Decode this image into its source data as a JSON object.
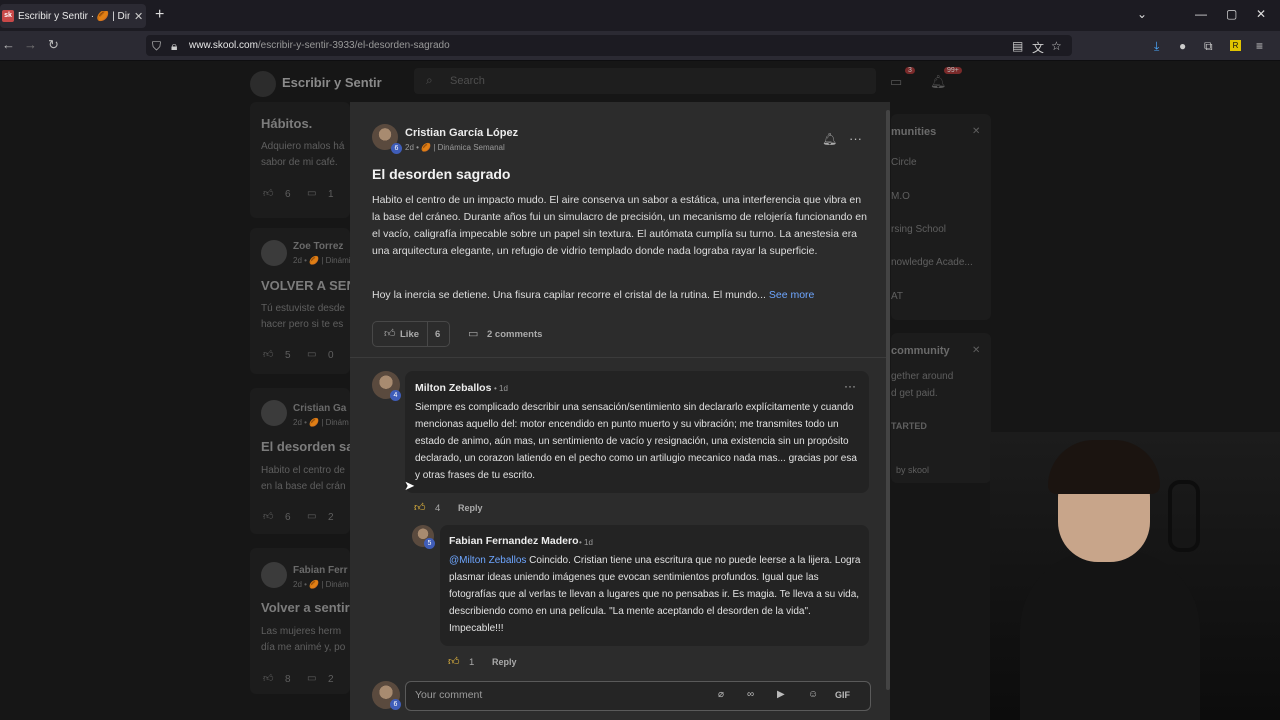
{
  "browser": {
    "tab_title": "Escribir y Sentir · 🏉 | Dinámica",
    "tab_favicon": "sk",
    "url_host": "www.skool.com",
    "url_path": "/escribir-y-sentir-3933/el-desorden-sagrado"
  },
  "background": {
    "community_name": "Escribir y Sentir",
    "search_placeholder": "Search",
    "chat_badge": "3",
    "notif_badge": "99+",
    "posts": [
      {
        "title": "Hábitos.",
        "excerpt": "Adquiero malos há\nsabor de mi café.",
        "likes": "6",
        "comments": "1"
      },
      {
        "author": "Zoe Torrez",
        "meta": "2d • 🏉 | Dinámi",
        "title": "VOLVER A SENTI",
        "excerpt": "Tú estuviste desde\nhacer pero si te es",
        "likes": "5",
        "comments": "0"
      },
      {
        "author": "Cristian Ga",
        "meta": "2d • 🏉 | Dinám",
        "title": "El desorden sa",
        "excerpt": "Habito el centro de\nen la base del crán",
        "likes": "6",
        "comments": "2"
      },
      {
        "author": "Fabian Ferr",
        "meta": "2d • 🏉 | Dinám",
        "title": "Volver a sentir",
        "excerpt": "Las mujeres herm\ndía me animé y, po",
        "likes": "8",
        "comments": "2"
      }
    ],
    "sidebar": {
      "header": "munities",
      "items": [
        "Circle",
        "M.O",
        "rsing School",
        "nowledge Acade...",
        "AT"
      ],
      "community_header": "community",
      "community_text1": "gether around",
      "community_text2": "d get paid.",
      "community_btn": "TARTED",
      "powered": "by skool"
    }
  },
  "post": {
    "author": "Cristian García López",
    "level": "6",
    "meta": "2d • 🏉 | Dinámica Semanal",
    "title": "El desorden sagrado",
    "paragraph1": "Habito el centro de un impacto mudo. El aire conserva un sabor a estática, una interferencia que vibra en la base del cráneo. Durante años fui un simulacro de precisión, un mecanismo de relojería funcionando en el vacío, caligrafía impecable sobre un papel sin textura. El autómata cumplía su turno. La anestesia era una arquitectura elegante, un refugio de vidrio templado donde nada lograba rayar la superficie.",
    "paragraph2": "Hoy la inercia se detiene. Una fisura capilar recorre el cristal de la rutina. El mundo...",
    "see_more": "See more",
    "like_label": "Like",
    "like_count": "6",
    "comments_label": "2 comments"
  },
  "comments": [
    {
      "author": "Milton Zeballos",
      "level": "4",
      "time": "• 1d",
      "text": "Siempre es complicado describir una sensación/sentimiento sin declararlo explícitamente y cuando mencionas aquello del: motor encendido en punto muerto y su vibración; me transmites todo un estado de animo, aún mas, un sentimiento de vacío y resignación, una existencia sin un propósito declarado, un corazon latiendo en el pecho como un artilugio mecanico nada mas... gracias por esa y otras frases de tu escrito.",
      "likes": "4",
      "reply_label": "Reply"
    },
    {
      "author": "Fabian Fernandez Madero",
      "level": "5",
      "time": "• 1d",
      "mention": "@Milton Zeballos",
      "text": " Coincido. Cristian tiene una escritura que no puede leerse a la lijera. Logra plasmar ideas uniendo imágenes que evocan sentimientos profundos. Igual que las fotografías que al verlas te llevan a lugares que no pensabas ir. Es magia. Te lleva a su vida, describiendo como en una película. \"La mente aceptando el desorden de la vida\". Impecable!!!",
      "likes": "1",
      "reply_label": "Reply"
    }
  ],
  "composer": {
    "placeholder": "Your comment",
    "level": "6",
    "gif_label": "GIF"
  },
  "colors": {
    "accent_link": "#6ea6ff",
    "level_badge": "#3f5db8",
    "modal_bg": "#2c2c2c"
  }
}
